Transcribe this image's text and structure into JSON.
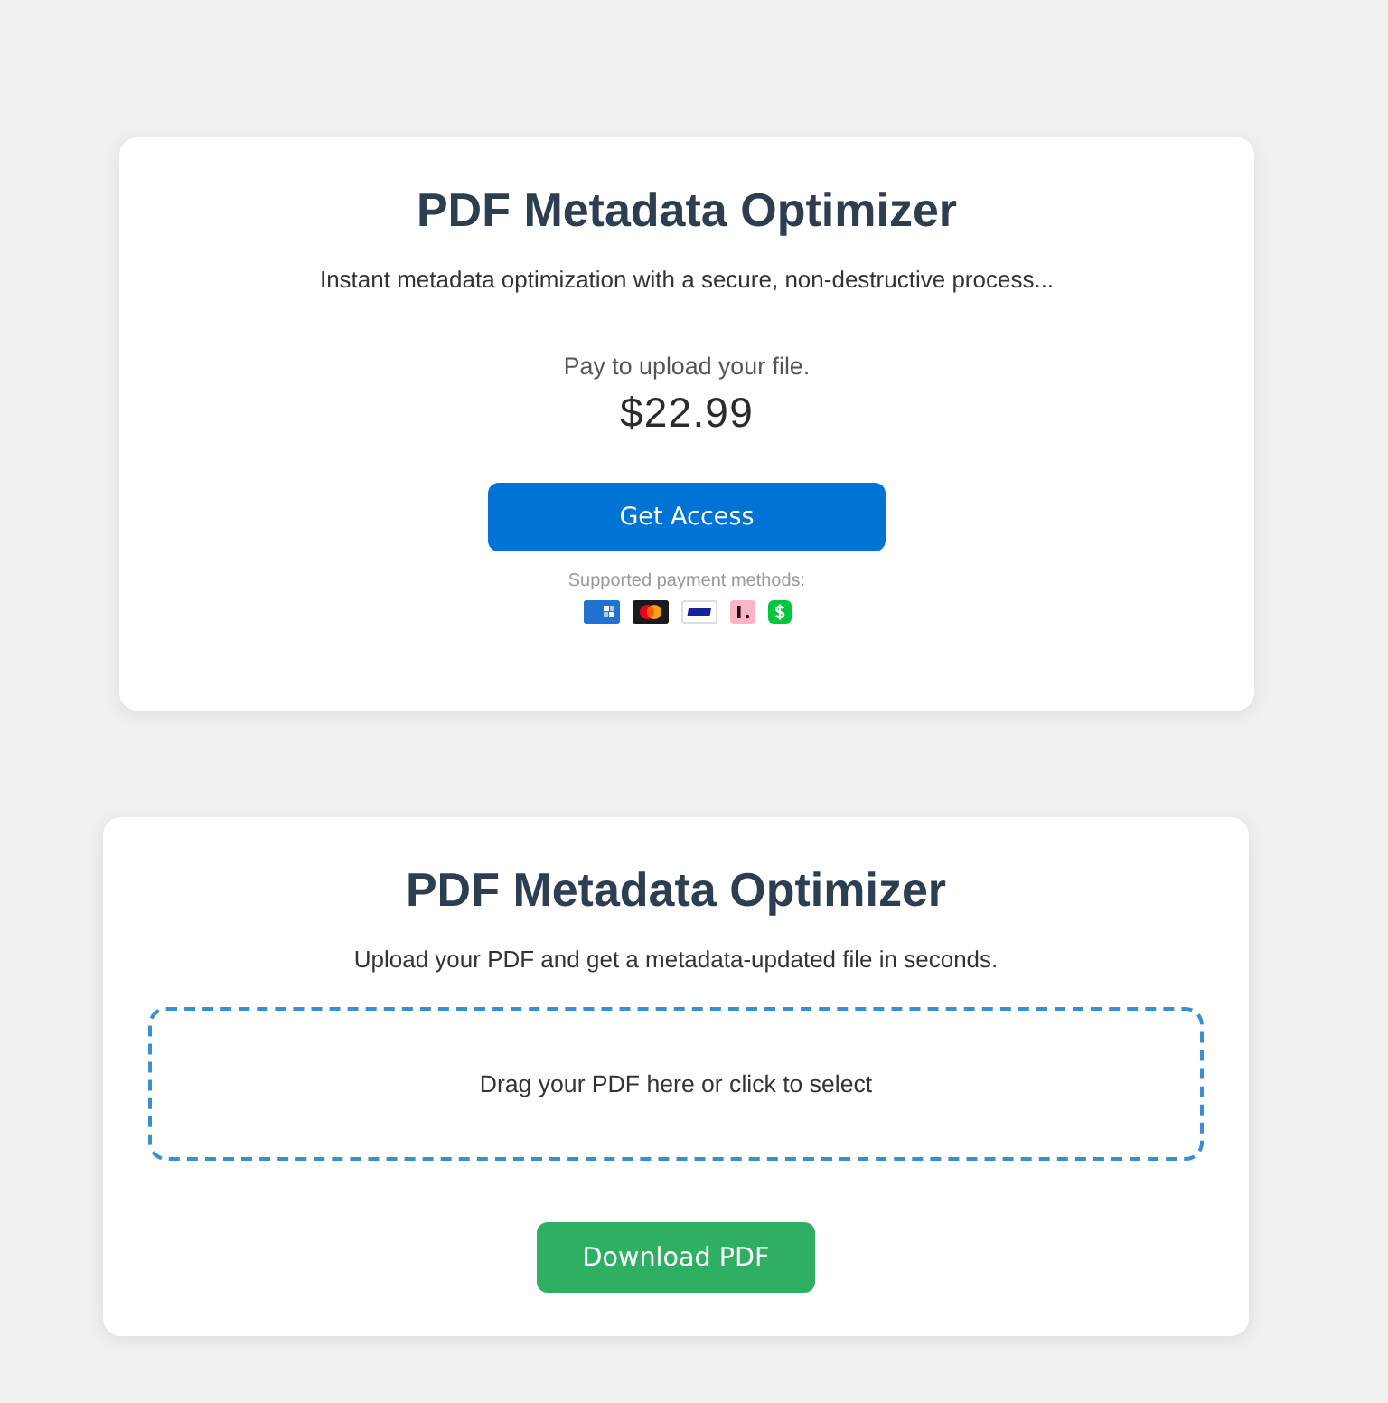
{
  "payment_card": {
    "title": "PDF Metadata Optimizer",
    "subtitle": "Instant metadata optimization with a secure, non-destructive process...",
    "prompt": "Pay to upload your file.",
    "price": "$22.99",
    "button": "Get Access",
    "methods_label": "Supported payment methods:",
    "methods": [
      {
        "kind": "amex"
      },
      {
        "kind": "mastercard"
      },
      {
        "kind": "visa"
      },
      {
        "kind": "klarna"
      },
      {
        "kind": "cashapp"
      }
    ]
  },
  "upload_card": {
    "title": "PDF Metadata Optimizer",
    "subtitle": "Upload your PDF and get a metadata-updated file in seconds.",
    "dropzone": {
      "placeholder": "Drag your PDF here or click to select"
    },
    "button": "Download PDF"
  }
}
